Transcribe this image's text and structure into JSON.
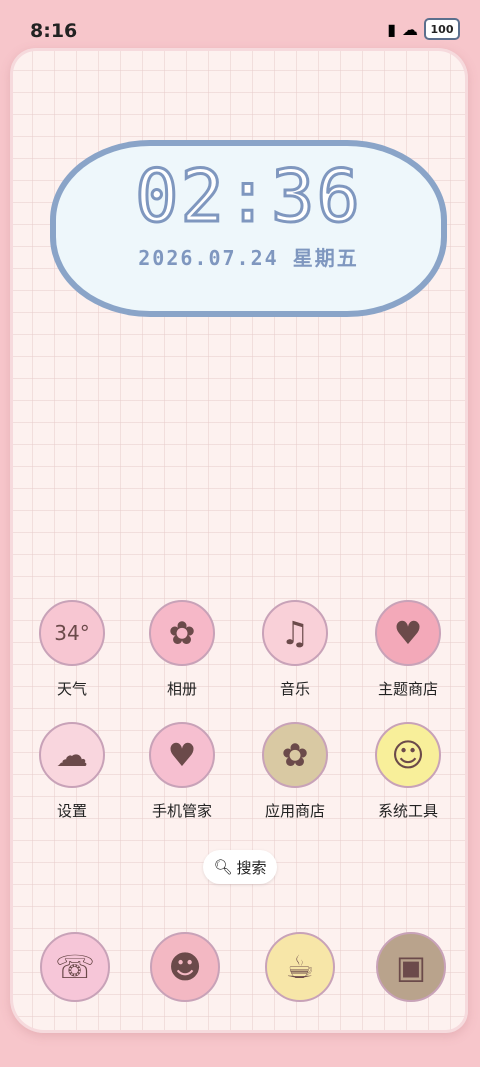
{
  "status": {
    "time": "8:16",
    "battery": "100"
  },
  "clock": {
    "time": "02:36",
    "date": "2026.07.24 星期五"
  },
  "apps": [
    {
      "label": "天气",
      "icon": "weather-cloud-icon",
      "glyph": "34°",
      "color": "#f7c6d2"
    },
    {
      "label": "相册",
      "icon": "gallery-icon",
      "glyph": "✿",
      "color": "#f6b8c8"
    },
    {
      "label": "音乐",
      "icon": "music-note-icon",
      "glyph": "♫",
      "color": "#f9d0d8"
    },
    {
      "label": "主题商店",
      "icon": "theme-store-icon",
      "glyph": "♥",
      "color": "#f3a9b9"
    },
    {
      "label": "设置",
      "icon": "settings-icon",
      "glyph": "☁",
      "color": "#f9d6de"
    },
    {
      "label": "手机管家",
      "icon": "phone-manager-icon",
      "glyph": "♥",
      "color": "#f6bfd0"
    },
    {
      "label": "应用商店",
      "icon": "app-store-icon",
      "glyph": "✿",
      "color": "#d9c9a3"
    },
    {
      "label": "系统工具",
      "icon": "system-tools-icon",
      "glyph": "☺",
      "color": "#f8ef9a"
    }
  ],
  "search": {
    "label": "搜索"
  },
  "dock": [
    {
      "icon": "phone-dialer-icon",
      "glyph": "☏",
      "color": "#f6c6d8"
    },
    {
      "icon": "messages-icon",
      "glyph": "☻",
      "color": "#f3b8c3"
    },
    {
      "icon": "browser-icon",
      "glyph": "☕",
      "color": "#f7e6a8"
    },
    {
      "icon": "camera-icon",
      "glyph": "▣",
      "color": "#b9a38c"
    }
  ]
}
